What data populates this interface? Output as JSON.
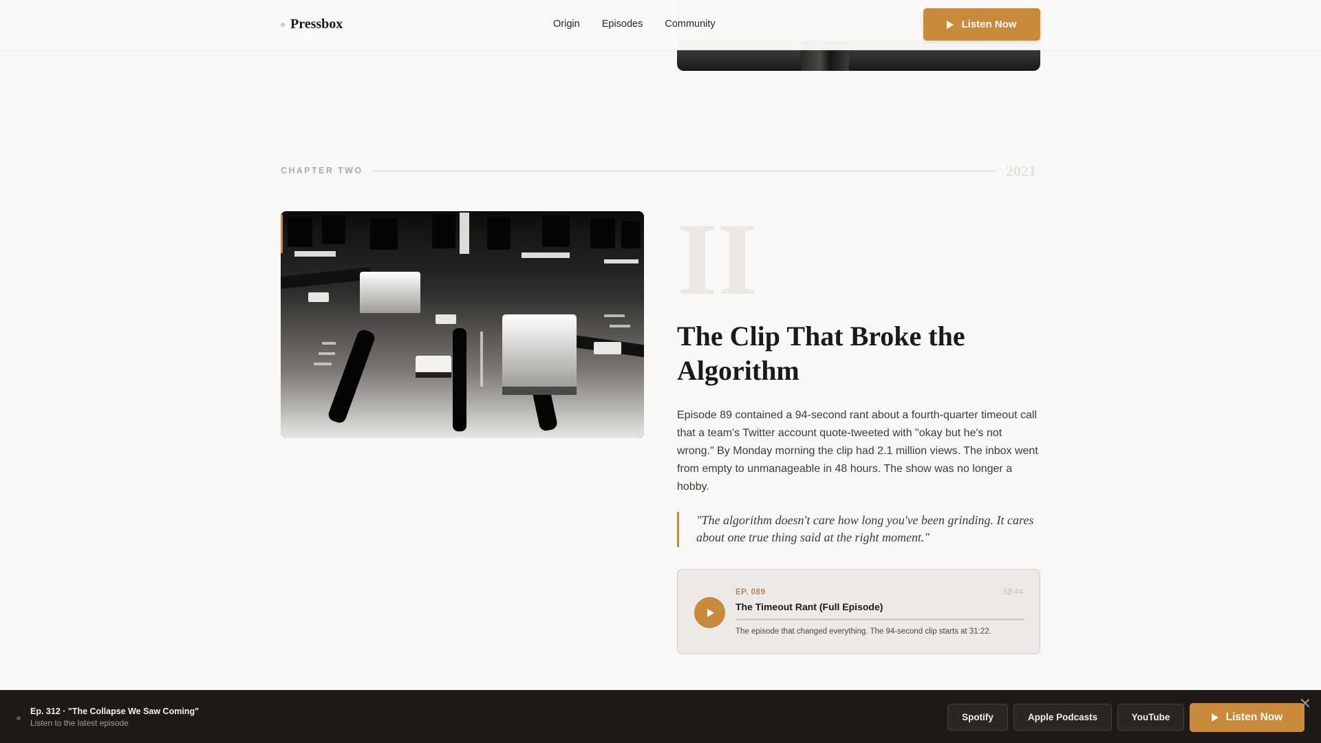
{
  "header": {
    "brand": "Pressbox",
    "nav": [
      "Origin",
      "Episodes",
      "Community"
    ],
    "cta_label": "Listen Now"
  },
  "chapter": {
    "label": "CHAPTER TWO",
    "year": "2021",
    "numeral": "II",
    "title": "The Clip That Broke the Algorithm",
    "body": "Episode 89 contained a 94-second rant about a fourth-quarter timeout call that a team's Twitter account quote-tweeted with \"okay but he's not wrong.\" By Monday morning the clip had 2.1 million views. The inbox went from empty to unmanageable in 48 hours. The show was no longer a hobby.",
    "quote": "\"The algorithm doesn't care how long you've been grinding. It cares about one true thing said at the right moment.\""
  },
  "episode_card": {
    "number": "EP. 089",
    "duration": "58:44",
    "title": "The Timeout Rant (Full Episode)",
    "description": "The episode that changed everything. The 94-second clip starts at 31:22.",
    "progress": 0
  },
  "bottom_bar": {
    "title": "Ep. 312 · \"The Collapse We Saw Coming\"",
    "subtitle": "Listen to the latest episode",
    "platforms": [
      "Spotify",
      "Apple Podcasts",
      "YouTube"
    ],
    "cta_label": "Listen Now"
  },
  "colors": {
    "accent": "#c8893a",
    "background": "#f9f8f6",
    "bar": "#1d1a17"
  },
  "icons": [
    "play-icon",
    "close-icon"
  ]
}
